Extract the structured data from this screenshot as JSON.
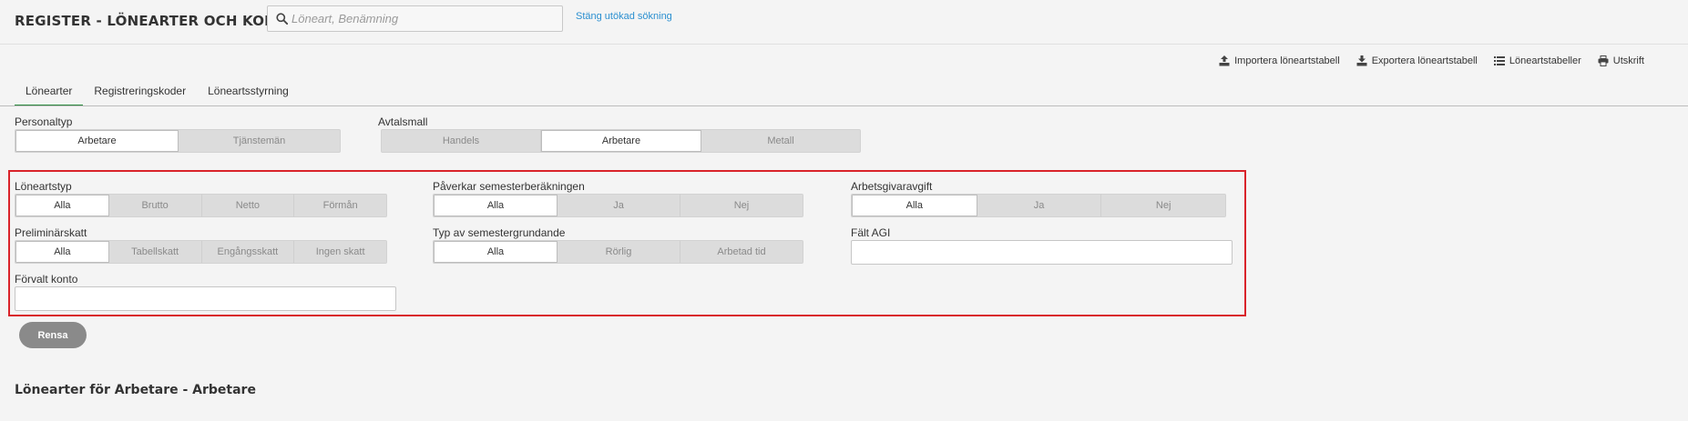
{
  "header": {
    "title": "REGISTER - LÖNEARTER OCH KODER",
    "search_placeholder": "Löneart, Benämning",
    "close_extended_search": "Stäng utökad sökning"
  },
  "toolbar": {
    "import": "Importera löneartstabell",
    "export": "Exportera löneartstabell",
    "tables": "Löneartstabeller",
    "print": "Utskrift"
  },
  "tabs": [
    "Lönearter",
    "Registreringskoder",
    "Löneartsstyrning"
  ],
  "personaltyp": {
    "label": "Personaltyp",
    "options": [
      "Arbetare",
      "Tjänstemän"
    ],
    "selected": "Arbetare"
  },
  "avtalsmall": {
    "label": "Avtalsmall",
    "options": [
      "Handels",
      "Arbetare",
      "Metall"
    ],
    "selected": "Arbetare"
  },
  "filters": {
    "loneartstyp": {
      "label": "Löneartstyp",
      "options": [
        "Alla",
        "Brutto",
        "Netto",
        "Förmån"
      ],
      "selected": "Alla"
    },
    "semesterberakning": {
      "label": "Påverkar semesterberäkningen",
      "options": [
        "Alla",
        "Ja",
        "Nej"
      ],
      "selected": "Alla"
    },
    "arbetsgivaravgift": {
      "label": "Arbetsgivaravgift",
      "options": [
        "Alla",
        "Ja",
        "Nej"
      ],
      "selected": "Alla"
    },
    "preliminarskatt": {
      "label": "Preliminärskatt",
      "options": [
        "Alla",
        "Tabellskatt",
        "Engångsskatt",
        "Ingen skatt"
      ],
      "selected": "Alla"
    },
    "semestergrundande": {
      "label": "Typ av semestergrundande",
      "options": [
        "Alla",
        "Rörlig",
        "Arbetad tid"
      ],
      "selected": "Alla"
    },
    "falt_agi": {
      "label": "Fält AGI",
      "value": ""
    },
    "forvalt_konto": {
      "label": "Förvalt konto",
      "value": ""
    }
  },
  "actions": {
    "clear": "Rensa"
  },
  "section_title": "Lönearter för Arbetare - Arbetare",
  "colors": {
    "accent_tab": "#2b8a3e",
    "link": "#2a8fd0",
    "highlight_border": "#d9232a",
    "button_gray": "#8a8a8a"
  }
}
